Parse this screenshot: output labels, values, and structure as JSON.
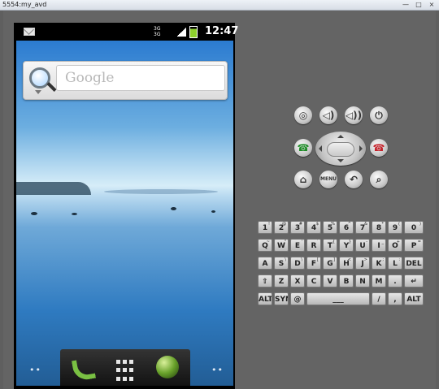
{
  "window": {
    "title": "5554:my_avd",
    "buttons": [
      "—",
      "□",
      "×"
    ]
  },
  "statusbar": {
    "network": [
      "3G",
      "3G"
    ],
    "time": "12:47"
  },
  "home": {
    "search_placeholder": "Google",
    "dots": "••"
  },
  "controls": {
    "buttons": [
      {
        "name": "camera-button",
        "label": "◎"
      },
      {
        "name": "volume-down-button",
        "label": "◁)"
      },
      {
        "name": "volume-up-button",
        "label": "◁))"
      },
      {
        "name": "power-button",
        "label": "⏻"
      },
      {
        "name": "call-button",
        "label": "☎"
      },
      {
        "name": "end-call-button",
        "label": "☎"
      },
      {
        "name": "home-button",
        "label": "⌂"
      },
      {
        "name": "menu-button",
        "label": "MENU"
      },
      {
        "name": "back-button",
        "label": "↶"
      },
      {
        "name": "search-button",
        "label": "⌕"
      }
    ]
  },
  "keyboard": {
    "row1": [
      {
        "main": "1",
        "small": "!"
      },
      {
        "main": "2",
        "small": "@"
      },
      {
        "main": "3",
        "small": "#"
      },
      {
        "main": "4",
        "small": "$"
      },
      {
        "main": "5",
        "small": "%"
      },
      {
        "main": "6",
        "small": "^"
      },
      {
        "main": "7",
        "small": "&"
      },
      {
        "main": "8",
        "small": "*"
      },
      {
        "main": "9",
        "small": "("
      },
      {
        "main": "0",
        "small": ")"
      }
    ],
    "row2": [
      {
        "main": "Q",
        "small": "~"
      },
      {
        "main": "W",
        "small": "\""
      },
      {
        "main": "E",
        "small": "'"
      },
      {
        "main": "R",
        "small": "`"
      },
      {
        "main": "T",
        "small": "{"
      },
      {
        "main": "Y",
        "small": "}"
      },
      {
        "main": "U",
        "small": "-"
      },
      {
        "main": "I",
        "small": "_"
      },
      {
        "main": "O",
        "small": "+"
      },
      {
        "main": "P",
        "small": "="
      }
    ],
    "row3": [
      {
        "main": "A",
        "small": ""
      },
      {
        "main": "S",
        "small": "\\"
      },
      {
        "main": "D",
        "small": "\\"
      },
      {
        "main": "F",
        "small": "["
      },
      {
        "main": "G",
        "small": "]"
      },
      {
        "main": "H",
        "small": "<"
      },
      {
        "main": "J",
        "small": ">"
      },
      {
        "main": "K",
        "small": ";"
      },
      {
        "main": "L",
        "small": ":"
      },
      {
        "main": "DEL",
        "small": ""
      }
    ],
    "row4": [
      {
        "main": "⇧",
        "small": ""
      },
      {
        "main": "Z",
        "small": ""
      },
      {
        "main": "X",
        "small": ""
      },
      {
        "main": "C",
        "small": ""
      },
      {
        "main": "V",
        "small": ""
      },
      {
        "main": "B",
        "small": ""
      },
      {
        "main": "N",
        "small": ""
      },
      {
        "main": "M",
        "small": ""
      },
      {
        "main": ".",
        "small": ""
      },
      {
        "main": "↵",
        "small": ""
      }
    ],
    "row5": [
      {
        "main": "ALT",
        "small": ""
      },
      {
        "main": "SYM",
        "small": ""
      },
      {
        "main": "@",
        "small": ""
      },
      {
        "main": "___",
        "small": ""
      },
      {
        "main": "/",
        "small": ""
      },
      {
        "main": ",",
        "small": ""
      },
      {
        "main": "ALT",
        "small": ""
      }
    ]
  }
}
